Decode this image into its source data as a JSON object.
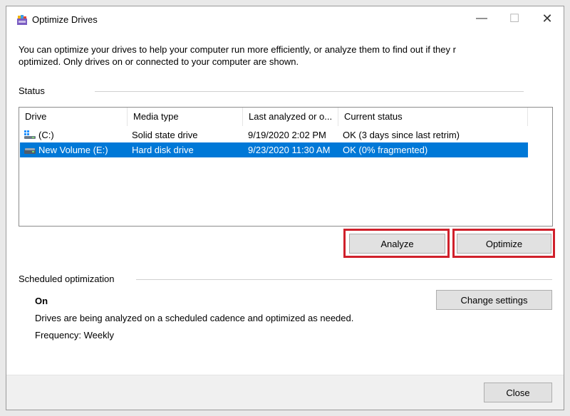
{
  "window": {
    "title": "Optimize Drives",
    "minimize_glyph": "—",
    "maximize_glyph": "☐",
    "close_glyph": "✕"
  },
  "description": {
    "line1": "You can optimize your drives to help your computer run more efficiently, or analyze them to find out if they r",
    "line2": "optimized. Only drives on or connected to your computer are shown."
  },
  "status": {
    "label": "Status",
    "columns": [
      "Drive",
      "Media type",
      "Last analyzed or o...",
      "Current status"
    ],
    "drives": [
      {
        "name": "(C:)",
        "media_type": "Solid state drive",
        "last_analyzed": "9/19/2020 2:02 PM",
        "current_status": "OK (3 days since last retrim)",
        "icon": "windows-drive-icon",
        "selected": false
      },
      {
        "name": "New Volume (E:)",
        "media_type": "Hard disk drive",
        "last_analyzed": "9/23/2020 11:30 AM",
        "current_status": "OK (0% fragmented)",
        "icon": "hard-disk-drive-icon",
        "selected": true
      }
    ],
    "analyze_label": "Analyze",
    "optimize_label": "Optimize"
  },
  "scheduled": {
    "label": "Scheduled optimization",
    "state": "On",
    "description": "Drives are being analyzed on a scheduled cadence and optimized as needed.",
    "frequency": "Frequency: Weekly",
    "change_settings_label": "Change settings"
  },
  "footer": {
    "close_label": "Close"
  },
  "colors": {
    "selection": "#0078d7",
    "highlight_outline": "#d0202b",
    "button_face": "#e1e1e1"
  }
}
